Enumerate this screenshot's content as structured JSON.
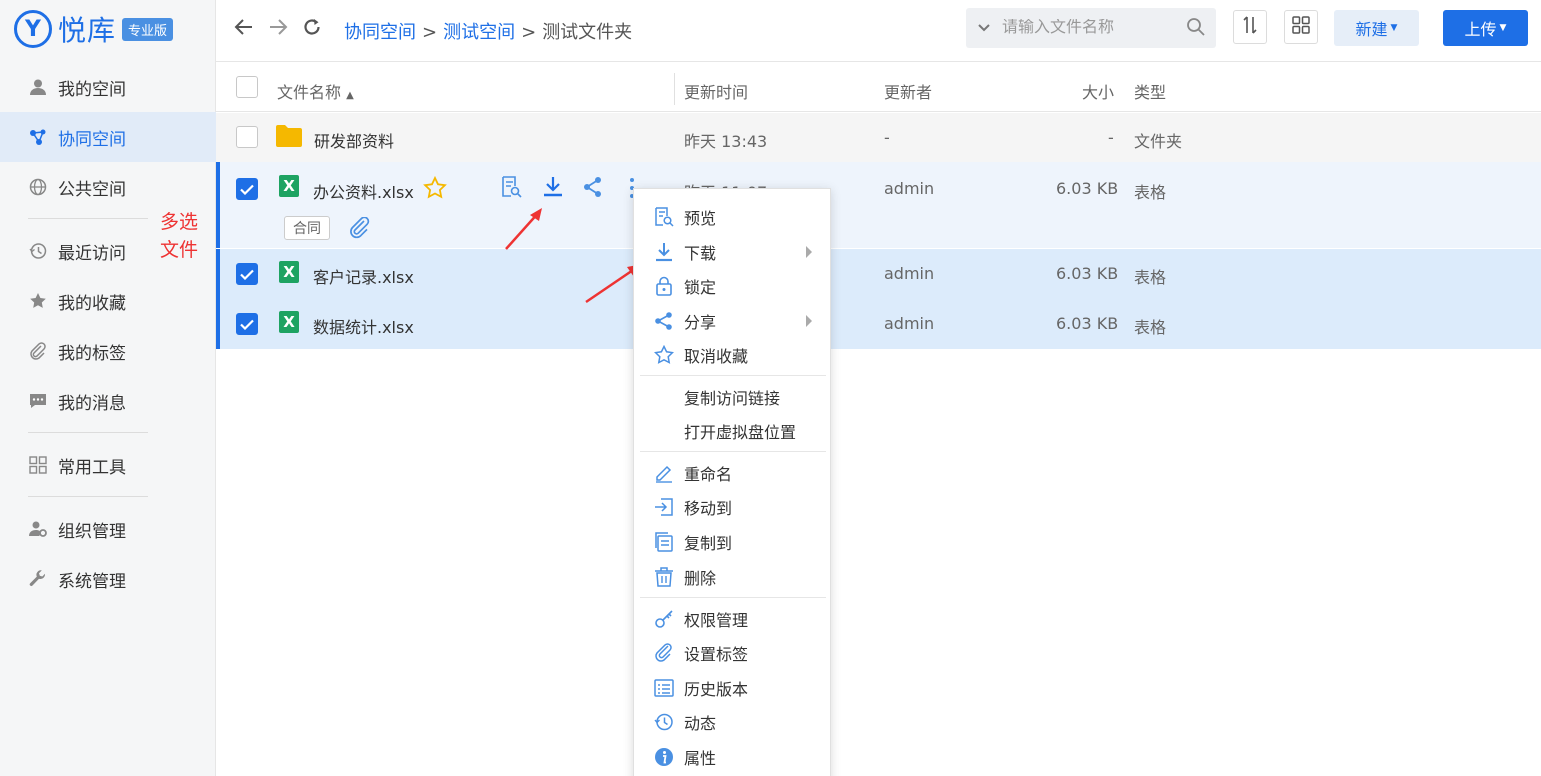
{
  "app": {
    "logo_mark": "Y",
    "logo_text": "悦库",
    "edition": "专业版"
  },
  "sidebar": {
    "items": [
      {
        "label": "我的空间",
        "icon": "user-icon"
      },
      {
        "label": "协同空间",
        "icon": "share-network-icon",
        "active": true
      },
      {
        "label": "公共空间",
        "icon": "globe-icon"
      },
      {
        "label": "最近访问",
        "icon": "history-icon"
      },
      {
        "label": "我的收藏",
        "icon": "star-icon"
      },
      {
        "label": "我的标签",
        "icon": "paperclip-icon"
      },
      {
        "label": "我的消息",
        "icon": "message-icon"
      },
      {
        "label": "常用工具",
        "icon": "grid-icon"
      },
      {
        "label": "组织管理",
        "icon": "org-user-gear-icon"
      },
      {
        "label": "系统管理",
        "icon": "wrench-icon"
      }
    ],
    "annotation": "多选文件"
  },
  "breadcrumb": {
    "items": [
      "协同空间",
      "测试空间",
      "测试文件夹"
    ],
    "separator": ">"
  },
  "search": {
    "placeholder": "请输入文件名称"
  },
  "toolbar": {
    "new_label": "新建",
    "upload_label": "上传"
  },
  "table": {
    "headers": {
      "name": "文件名称",
      "updated": "更新时间",
      "updater": "更新者",
      "size": "大小",
      "type": "类型"
    },
    "rows": [
      {
        "name": "研发部资料",
        "updated": "昨天 13:43",
        "updater": "-",
        "size": "-",
        "type": "文件夹"
      },
      {
        "name": "办公资料.xlsx",
        "updated": "昨天 11:07",
        "updater": "admin",
        "size": "6.03 KB",
        "type": "表格",
        "tag": "合同"
      },
      {
        "name": "客户记录.xlsx",
        "updated": "",
        "updater": "admin",
        "size": "6.03 KB",
        "type": "表格"
      },
      {
        "name": "数据统计.xlsx",
        "updated": "",
        "updater": "admin",
        "size": "6.03 KB",
        "type": "表格"
      }
    ]
  },
  "context_menu": {
    "items": [
      "预览",
      "下载",
      "锁定",
      "分享",
      "取消收藏",
      "复制访问链接",
      "打开虚拟盘位置",
      "重命名",
      "移动到",
      "复制到",
      "删除",
      "权限管理",
      "设置标签",
      "历史版本",
      "动态",
      "属性"
    ]
  },
  "colors": {
    "accent": "#1e6fe6",
    "folder": "#f5b800",
    "excel": "#1ea362",
    "annotation": "#e33333"
  }
}
